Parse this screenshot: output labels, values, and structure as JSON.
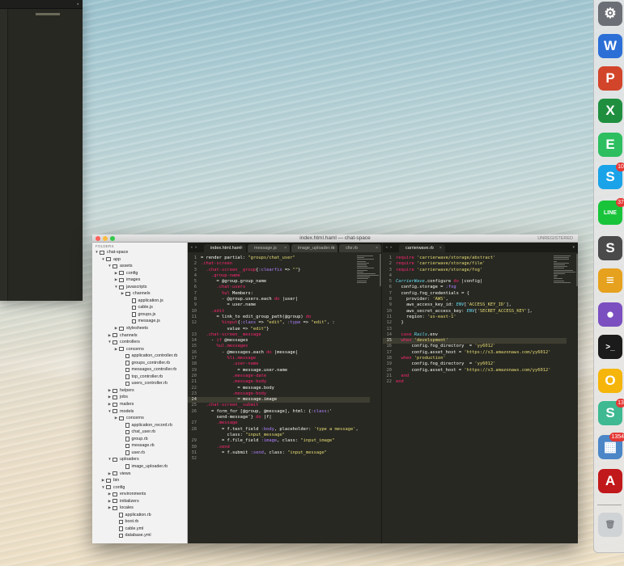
{
  "editor": {
    "title": "index.html.haml — chat-space",
    "unregistered": "UNREGISTERED",
    "sidebar_header": "FOLDERS",
    "tree": [
      {
        "label": "chat-space",
        "indent": 0,
        "kind": "folder",
        "open": true
      },
      {
        "label": "app",
        "indent": 1,
        "kind": "folder",
        "open": true
      },
      {
        "label": "assets",
        "indent": 2,
        "kind": "folder",
        "open": true
      },
      {
        "label": "config",
        "indent": 3,
        "kind": "folder",
        "open": false
      },
      {
        "label": "images",
        "indent": 3,
        "kind": "folder",
        "open": false
      },
      {
        "label": "javascripts",
        "indent": 3,
        "kind": "folder",
        "open": true
      },
      {
        "label": "channels",
        "indent": 4,
        "kind": "folder",
        "open": false
      },
      {
        "label": "application.js",
        "indent": 5,
        "kind": "file"
      },
      {
        "label": "cable.js",
        "indent": 5,
        "kind": "file"
      },
      {
        "label": "groups.js",
        "indent": 5,
        "kind": "file"
      },
      {
        "label": "message.js",
        "indent": 5,
        "kind": "file"
      },
      {
        "label": "stylesheets",
        "indent": 3,
        "kind": "folder",
        "open": false
      },
      {
        "label": "channels",
        "indent": 2,
        "kind": "folder",
        "open": false
      },
      {
        "label": "controllers",
        "indent": 2,
        "kind": "folder",
        "open": true
      },
      {
        "label": "concerns",
        "indent": 3,
        "kind": "folder",
        "open": false
      },
      {
        "label": "application_controller.rb",
        "indent": 4,
        "kind": "file"
      },
      {
        "label": "groups_controller.rb",
        "indent": 4,
        "kind": "file"
      },
      {
        "label": "messages_controller.rb",
        "indent": 4,
        "kind": "file"
      },
      {
        "label": "top_controller.rb",
        "indent": 4,
        "kind": "file"
      },
      {
        "label": "users_controller.rb",
        "indent": 4,
        "kind": "file"
      },
      {
        "label": "helpers",
        "indent": 2,
        "kind": "folder",
        "open": false
      },
      {
        "label": "jobs",
        "indent": 2,
        "kind": "folder",
        "open": false
      },
      {
        "label": "mailers",
        "indent": 2,
        "kind": "folder",
        "open": false
      },
      {
        "label": "models",
        "indent": 2,
        "kind": "folder",
        "open": true
      },
      {
        "label": "concerns",
        "indent": 3,
        "kind": "folder",
        "open": false
      },
      {
        "label": "application_record.rb",
        "indent": 4,
        "kind": "file"
      },
      {
        "label": "chat_user.rb",
        "indent": 4,
        "kind": "file"
      },
      {
        "label": "group.rb",
        "indent": 4,
        "kind": "file"
      },
      {
        "label": "message.rb",
        "indent": 4,
        "kind": "file"
      },
      {
        "label": "user.rb",
        "indent": 4,
        "kind": "file"
      },
      {
        "label": "uploaders",
        "indent": 2,
        "kind": "folder",
        "open": true
      },
      {
        "label": "image_uploader.rb",
        "indent": 4,
        "kind": "file"
      },
      {
        "label": "views",
        "indent": 2,
        "kind": "folder",
        "open": false
      },
      {
        "label": "bin",
        "indent": 1,
        "kind": "folder",
        "open": false
      },
      {
        "label": "config",
        "indent": 1,
        "kind": "folder",
        "open": true
      },
      {
        "label": "environments",
        "indent": 2,
        "kind": "folder",
        "open": false
      },
      {
        "label": "initializers",
        "indent": 2,
        "kind": "folder",
        "open": false
      },
      {
        "label": "locales",
        "indent": 2,
        "kind": "folder",
        "open": false
      },
      {
        "label": "application.rb",
        "indent": 3,
        "kind": "file"
      },
      {
        "label": "boot.rb",
        "indent": 3,
        "kind": "file"
      },
      {
        "label": "cable.yml",
        "indent": 3,
        "kind": "file"
      },
      {
        "label": "database.yml",
        "indent": 3,
        "kind": "file"
      }
    ],
    "left_tabs": [
      {
        "label": "index.html.haml",
        "active": true
      },
      {
        "label": "message.js",
        "active": false
      },
      {
        "label": "image_uploader.rb",
        "active": false
      },
      {
        "label": "cfsr.rb",
        "active": false
      }
    ],
    "right_tabs": [
      {
        "label": "carrierwave.rb",
        "active": true
      }
    ],
    "left_code": [
      {
        "n": "1",
        "text": "= render partial: \"groups/chat_user\""
      },
      {
        "n": "2",
        "text": ".chat-screen"
      },
      {
        "n": "3",
        "text": "  .chat-screen__group{:clearfix => \"\"}"
      },
      {
        "n": "4",
        "text": "    .group-name"
      },
      {
        "n": "5",
        "text": "      = @group.group_name"
      },
      {
        "n": "6",
        "text": "      .chat-users"
      },
      {
        "n": "7",
        "text": "        %ul Members:"
      },
      {
        "n": "8",
        "text": "        - @group.users.each do |user|"
      },
      {
        "n": "9",
        "text": "          = user.name"
      },
      {
        "n": "10",
        "text": "    .edit"
      },
      {
        "n": "11",
        "text": "      = link_to edit_group_path(@group) do"
      },
      {
        "n": "12",
        "text": "        %input{:class => \"edit\", :type => \"edit\", :"
      },
      {
        "n": "",
        "text": "          value => \"edit\"}"
      },
      {
        "n": "13",
        "text": "  .chat-screen__message"
      },
      {
        "n": "14",
        "text": "    - if @messages"
      },
      {
        "n": "15",
        "text": "      %ul.messages"
      },
      {
        "n": "16",
        "text": "        - @messages.each do |message|"
      },
      {
        "n": "17",
        "text": "          %li.message"
      },
      {
        "n": "18",
        "text": "            .user-name"
      },
      {
        "n": "19",
        "text": "              = message.user.name"
      },
      {
        "n": "20",
        "text": "            .message-date"
      },
      {
        "n": "21",
        "text": "            .message-body"
      },
      {
        "n": "22",
        "text": "              = message.body"
      },
      {
        "n": "23",
        "text": "            .message-body"
      },
      {
        "n": "24",
        "text": "              = message.image",
        "hl": true
      },
      {
        "n": "25",
        "text": "  .chat-screen__submit"
      },
      {
        "n": "26",
        "text": "    = form_for [@group, @message], html: {:class:'"
      },
      {
        "n": "",
        "text": "      send-message'} do |f|"
      },
      {
        "n": "27",
        "text": "      .message"
      },
      {
        "n": "28",
        "text": "        = f.text_field :body, placeholder: 'type a message',"
      },
      {
        "n": "",
        "text": "          class: \"input_message\""
      },
      {
        "n": "29",
        "text": "        = f.file_field :image, class: \"input_image\""
      },
      {
        "n": "30",
        "text": "      .send"
      },
      {
        "n": "31",
        "text": "        = f.submit :send, class: \"input_message\""
      },
      {
        "n": "32",
        "text": ""
      }
    ],
    "right_code": [
      {
        "n": "1",
        "text": "require 'carrierwave/storage/abstract'"
      },
      {
        "n": "2",
        "text": "require 'carrierwave/storage/file'"
      },
      {
        "n": "3",
        "text": "require 'carrierwave/storage/fog'"
      },
      {
        "n": "4",
        "text": ""
      },
      {
        "n": "5",
        "text": "CarrierWave.configure do |config|"
      },
      {
        "n": "6",
        "text": "  config.storage = :fog"
      },
      {
        "n": "7",
        "text": "  config.fog_credentials = {"
      },
      {
        "n": "8",
        "text": "    provider: 'AWS',"
      },
      {
        "n": "9",
        "text": "    aws_access_key_id: ENV['ACCESS_KEY_ID'],"
      },
      {
        "n": "10",
        "text": "    aws_secret_access_key: ENV['SECRET_ACCESS_KEY'],"
      },
      {
        "n": "11",
        "text": "    region: 'us-east-1'"
      },
      {
        "n": "12",
        "text": "  }"
      },
      {
        "n": "13",
        "text": ""
      },
      {
        "n": "14",
        "text": "  case Rails.env"
      },
      {
        "n": "15",
        "text": "  when 'development'",
        "hl": true
      },
      {
        "n": "16",
        "text": "      config.fog_directory  = 'yy6012'"
      },
      {
        "n": "17",
        "text": "      config.asset_host = 'https://s3.amazonaws.com/yy6012'"
      },
      {
        "n": "18",
        "text": "  when 'production'"
      },
      {
        "n": "19",
        "text": "      config.fog_directory  = 'yy6012'"
      },
      {
        "n": "20",
        "text": "      config.asset_host = 'https://s3.amazonaws.com/yy6012'"
      },
      {
        "n": "21",
        "text": "  end"
      },
      {
        "n": "22",
        "text": "end"
      }
    ]
  },
  "dock": {
    "apps": [
      {
        "name": "system-preferences-icon",
        "glyph": "⚙",
        "color": "#6b6f75",
        "badge": ""
      },
      {
        "name": "word-icon",
        "glyph": "W",
        "color": "#2b6fd6",
        "badge": ""
      },
      {
        "name": "powerpoint-icon",
        "glyph": "P",
        "color": "#d2452b",
        "badge": ""
      },
      {
        "name": "excel-icon",
        "glyph": "X",
        "color": "#1f8f3f",
        "badge": ""
      },
      {
        "name": "evernote-icon",
        "glyph": "E",
        "color": "#2dbe60",
        "badge": ""
      },
      {
        "name": "skype-icon",
        "glyph": "S",
        "color": "#1aa3e8",
        "badge": "10"
      },
      {
        "name": "line-icon",
        "glyph": "LINE",
        "color": "#19c43b",
        "badge": "37"
      },
      {
        "name": "sublime-text-icon",
        "glyph": "S",
        "color": "#4a4a4a",
        "badge": ""
      },
      {
        "name": "sequel-pro-icon",
        "glyph": "≡",
        "color": "#e6a11e",
        "badge": ""
      },
      {
        "name": "github-desktop-icon",
        "glyph": "●",
        "color": "#7b4fc0",
        "badge": ""
      },
      {
        "name": "terminal-icon",
        "glyph": ">_",
        "color": "#1b1b1b",
        "badge": ""
      },
      {
        "name": "office-icon",
        "glyph": "O",
        "color": "#f5b50a",
        "badge": ""
      },
      {
        "name": "slack-icon",
        "glyph": "S",
        "color": "#3eb991",
        "badge": "13"
      },
      {
        "name": "preview-icon",
        "glyph": "▦",
        "color": "#4b86c7",
        "badge": "1354"
      },
      {
        "name": "acrobat-icon",
        "glyph": "A",
        "color": "#c1181b",
        "badge": ""
      },
      {
        "name": "trash-icon",
        "glyph": "🗑",
        "color": "#cfd3d6",
        "badge": ""
      }
    ]
  }
}
